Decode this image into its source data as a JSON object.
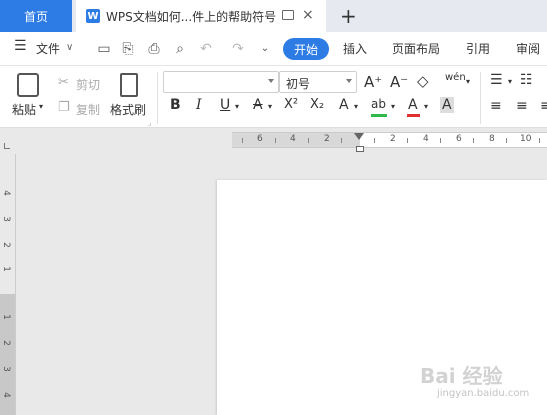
{
  "tabs": {
    "home": "首页",
    "doc_title": "WPS文档如何...件上的帮助符号",
    "doc_icon_letter": "W",
    "close": "×",
    "new_tab": "+"
  },
  "menu": {
    "file": "文件",
    "items": [
      "开始",
      "插入",
      "页面布局",
      "引用",
      "审阅"
    ]
  },
  "ribbon": {
    "paste": "粘贴",
    "cut": "剪切",
    "copy": "复制",
    "format_painter": "格式刷",
    "font_name": "",
    "font_size": "初号",
    "pinyin": "wén",
    "bold": "B",
    "italic": "I",
    "underline": "U",
    "strike": "A",
    "superscript": "X²",
    "subscript": "X₂",
    "effect": "A",
    "highlight": "ab",
    "font_color": "A",
    "char_shade": "A",
    "grow": "A⁺",
    "shrink": "A⁻"
  },
  "ruler": {
    "h_labels": [
      "6",
      "4",
      "2",
      "2",
      "4",
      "6",
      "8",
      "10"
    ],
    "v_labels": [
      "4",
      "3",
      "2",
      "1",
      "1",
      "2",
      "3",
      "4"
    ]
  },
  "watermark": {
    "text": "Bai 经验",
    "url": "jingyan.baidu.com"
  },
  "colors": {
    "accent": "#2d7be5",
    "highlight_bar": "#2fb94a",
    "font_color_bar": "#e03030"
  }
}
